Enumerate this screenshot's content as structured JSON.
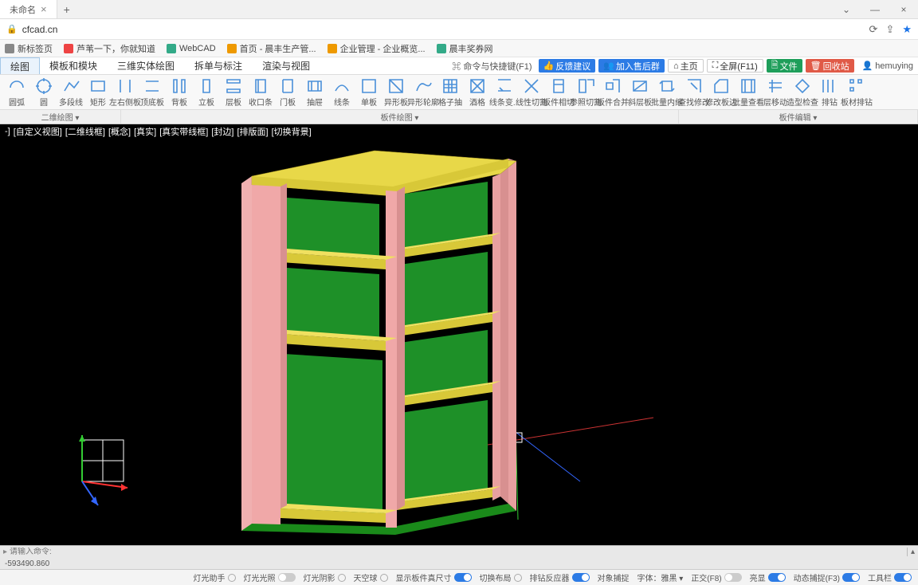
{
  "browser": {
    "tab_title": "未命名",
    "url": "cfcad.cn",
    "bookmarks": [
      {
        "label": "新标签页",
        "color": "#888"
      },
      {
        "label": "芦苇一下，你就知道",
        "color": "#e44"
      },
      {
        "label": "WebCAD",
        "color": "#3a8"
      },
      {
        "label": "首页 - 晨丰生产管...",
        "color": "#e90"
      },
      {
        "label": "企业管理 - 企业概览...",
        "color": "#e90"
      },
      {
        "label": "晨丰奖券网",
        "color": "#3a8"
      }
    ]
  },
  "menu": {
    "tabs": [
      "绘图",
      "模板和模块",
      "三维实体绘图",
      "拆单与标注",
      "渲染与视图"
    ],
    "right": {
      "cmd": "命令与快捷键(F1)",
      "feedback": "反馈建议",
      "group": "加入售后群",
      "home": "主页",
      "full": "全屏(F11)",
      "file": "文件",
      "recycle": "回收站",
      "user": "hemuying"
    }
  },
  "ribbon": [
    {
      "label": "圆弧"
    },
    {
      "label": "圆"
    },
    {
      "label": "多段线"
    },
    {
      "label": "矩形"
    },
    {
      "label": "左右侧板"
    },
    {
      "label": "顶底板"
    },
    {
      "label": "背板"
    },
    {
      "label": "立板"
    },
    {
      "label": "层板"
    },
    {
      "label": "收口条"
    },
    {
      "label": "门板"
    },
    {
      "label": "抽屉"
    },
    {
      "label": "线条"
    },
    {
      "label": "单板"
    },
    {
      "label": "异形板"
    },
    {
      "label": "异形轮廓"
    },
    {
      "label": "格子抽"
    },
    {
      "label": "酒格"
    },
    {
      "label": "线条变..."
    },
    {
      "label": "线性切割"
    },
    {
      "label": "板件相切"
    },
    {
      "label": "参照切割"
    },
    {
      "label": "板件合并"
    },
    {
      "label": "斜层板"
    },
    {
      "label": "批量内缩"
    },
    {
      "label": "查找修改"
    },
    {
      "label": "修改板边"
    },
    {
      "label": "批量查看"
    },
    {
      "label": "层移动"
    },
    {
      "label": "造型检查"
    },
    {
      "label": "排钻"
    },
    {
      "label": "板材排钻"
    }
  ],
  "sub_ribbon": [
    "二维绘图 ▾",
    "",
    "板件绘图 ▾",
    "",
    "",
    "",
    "",
    "",
    "",
    "",
    "",
    "",
    "",
    "",
    "",
    "",
    "",
    "",
    "",
    "板件编辑 ▾"
  ],
  "view_status": [
    "-]",
    "[自定义视图]",
    "[二维线框]",
    "[概念]",
    "[真实]",
    "[真实带线框]",
    "[封边]",
    "[排版面]",
    "[切换背景]"
  ],
  "command": {
    "prompt": "请输入命令:",
    "coords": "-593490.860"
  },
  "status": [
    {
      "label": "灯光助手",
      "type": "radio"
    },
    {
      "label": "灯光光照",
      "type": "toggle",
      "on": false
    },
    {
      "label": "灯光阴影",
      "type": "radio"
    },
    {
      "label": "天空球",
      "type": "radio"
    },
    {
      "label": "显示板件真尺寸",
      "type": "toggle",
      "on": true
    },
    {
      "label": "切换布局",
      "type": "radio"
    },
    {
      "label": "排钻反应器",
      "type": "toggle",
      "on": true
    },
    {
      "label": "对象捕捉",
      "type": "text"
    },
    {
      "label": "字体：雅黑 ▾",
      "type": "text"
    },
    {
      "label": "正交(F8)",
      "type": "toggle",
      "on": false
    },
    {
      "label": "亮显",
      "type": "toggle",
      "on": true
    },
    {
      "label": "动态捕捉(F3)",
      "type": "toggle",
      "on": true
    },
    {
      "label": "工具栏",
      "type": "toggle",
      "on": true
    }
  ]
}
